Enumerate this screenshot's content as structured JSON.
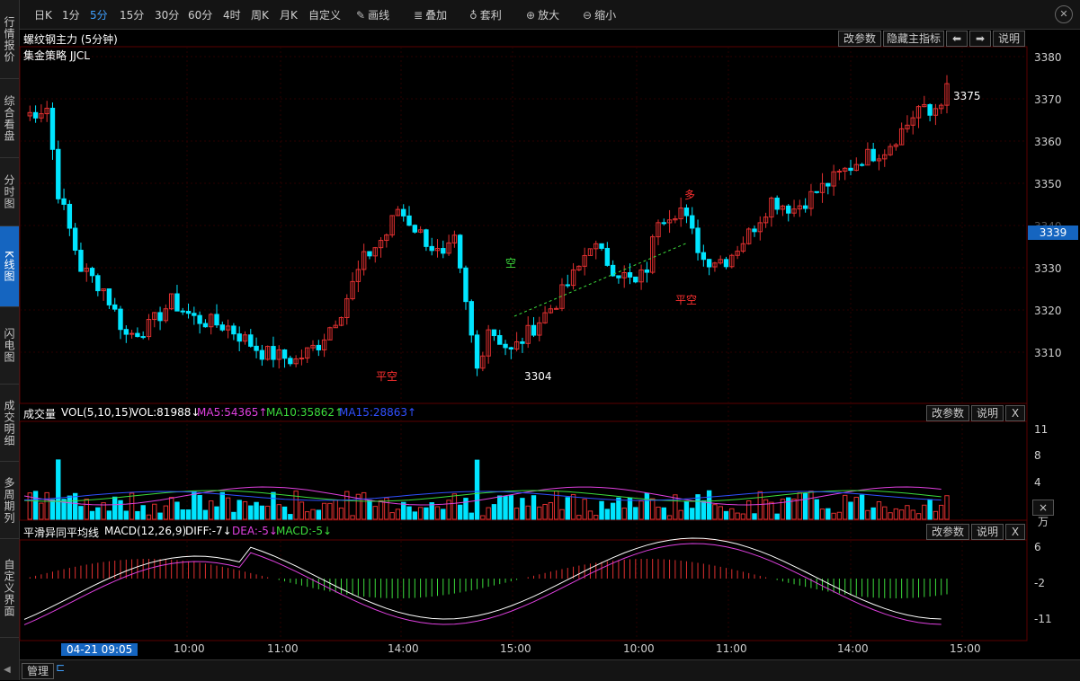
{
  "sidebar": {
    "items": [
      {
        "label": "行情报价",
        "active": false
      },
      {
        "label": "综合看盘",
        "active": false
      },
      {
        "label": "分时图",
        "active": false
      },
      {
        "label": "K线图",
        "active": true
      },
      {
        "label": "闪电图",
        "active": false
      },
      {
        "label": "成交明细",
        "active": false
      },
      {
        "label": "多周期列",
        "active": false
      },
      {
        "label": "自定义界面",
        "active": false
      }
    ]
  },
  "toolbar": {
    "periods": [
      "日K",
      "1分",
      "5分",
      "15分",
      "30分",
      "60分",
      "4时",
      "周K",
      "月K",
      "自定义"
    ],
    "active_period": "5分",
    "draw_label": "画线",
    "overlay_label": "叠加",
    "arb_label": "套利",
    "zoom_in_label": "放大",
    "zoom_out_label": "缩小"
  },
  "main_chart": {
    "title": "螺纹钢主力 (5分钟)",
    "strategy": "集金策略 JJCL",
    "buttons": {
      "params": "改参数",
      "hide": "隐藏主指标",
      "explain": "说明"
    },
    "price_axis": [
      "3380",
      "3370",
      "3360",
      "3350",
      "3340",
      "3330",
      "3320",
      "3310"
    ],
    "current_price": "3339",
    "annotations": {
      "high_label": "3375",
      "low_label": "3304",
      "sell_signal": "空",
      "buy_signal": "多",
      "close_short_1": "平空",
      "close_short_2": "平空"
    }
  },
  "volume_panel": {
    "title": "成交量",
    "indicator": "VOL(5,10,15)",
    "vol": "VOL:81988↓",
    "ma5": "MA5:54365↑",
    "ma10": "MA10:35862↑",
    "ma15": "MA15:28863↑",
    "buttons": {
      "params": "改参数",
      "explain": "说明",
      "close": "X"
    },
    "axis": [
      "11",
      "8",
      "4"
    ],
    "unit": "×万"
  },
  "macd_panel": {
    "title": "平滑异同平均线",
    "indicator": "MACD(12,26,9)",
    "diff": "DIFF:-7↓",
    "dea": "DEA:-5↓",
    "macd": "MACD:-5↓",
    "buttons": {
      "params": "改参数",
      "explain": "说明",
      "close": "X"
    },
    "axis": [
      "6",
      "-2",
      "-11"
    ]
  },
  "time_axis": {
    "start_label": "04-21 09:05",
    "labels": [
      "10:00",
      "11:00",
      "14:00",
      "15:00",
      "10:00",
      "11:00",
      "14:00",
      "15:00"
    ]
  },
  "bottom": {
    "manage": "管理"
  },
  "colors": {
    "up": "#e03030",
    "down": "#00e5ff",
    "bg": "#000000",
    "accent": "#1565c0"
  }
}
